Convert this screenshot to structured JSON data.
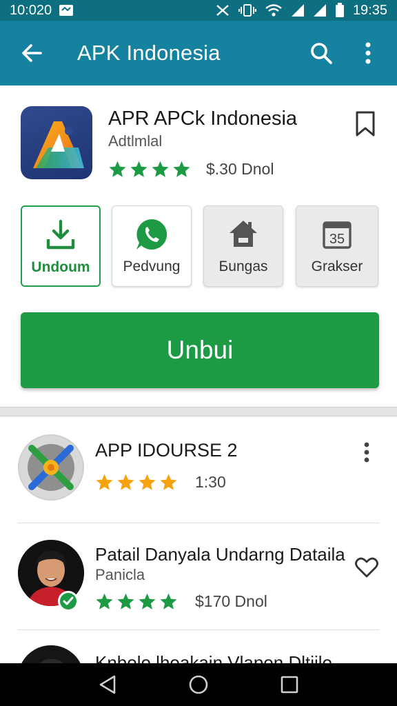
{
  "status_bar": {
    "time_left": "10:020",
    "time_right": "19:35"
  },
  "app_bar": {
    "title": "APK Indonesia",
    "icons": [
      "back-arrow-icon",
      "search-icon",
      "more-vert-icon"
    ]
  },
  "app": {
    "name": "APR APCk Indonesia",
    "developer": "Adtlmlal",
    "rating_stars": 4,
    "price": "$.30 Dnol",
    "accent": "#1d9a44"
  },
  "tiles": [
    {
      "label": "Undoum",
      "icon": "download-icon",
      "selected": true
    },
    {
      "label": "Pedvung",
      "icon": "whatsapp-icon",
      "selected": false
    },
    {
      "label": "Бungas",
      "icon": "home-icon",
      "selected": false
    },
    {
      "label": "Grakser",
      "icon": "calendar-icon",
      "selected": false,
      "badge": "35"
    }
  ],
  "install_button": {
    "label": "Unbui"
  },
  "list": [
    {
      "title": "APP IDOURSE 2",
      "subtitle": "",
      "rating_stars": 4,
      "extra": "1:30",
      "star_color": "#f4a20f",
      "action": "more-vert-icon"
    },
    {
      "title": "Patail Danyala Undarng Dataila",
      "subtitle": "Panicla",
      "rating_stars": 4,
      "extra": "$170 Dnol",
      "star_color": "#1d9a44",
      "action": "heart-icon"
    },
    {
      "title": "Knbolo lhoakain Vlapon Dltiilo",
      "subtitle": "",
      "rating_stars": 0,
      "extra": "",
      "action": ""
    }
  ],
  "colors": {
    "status_bar": "#0e6f80",
    "app_bar": "#1583a0",
    "green": "#1d9a44",
    "orange_star": "#f4a20f"
  }
}
